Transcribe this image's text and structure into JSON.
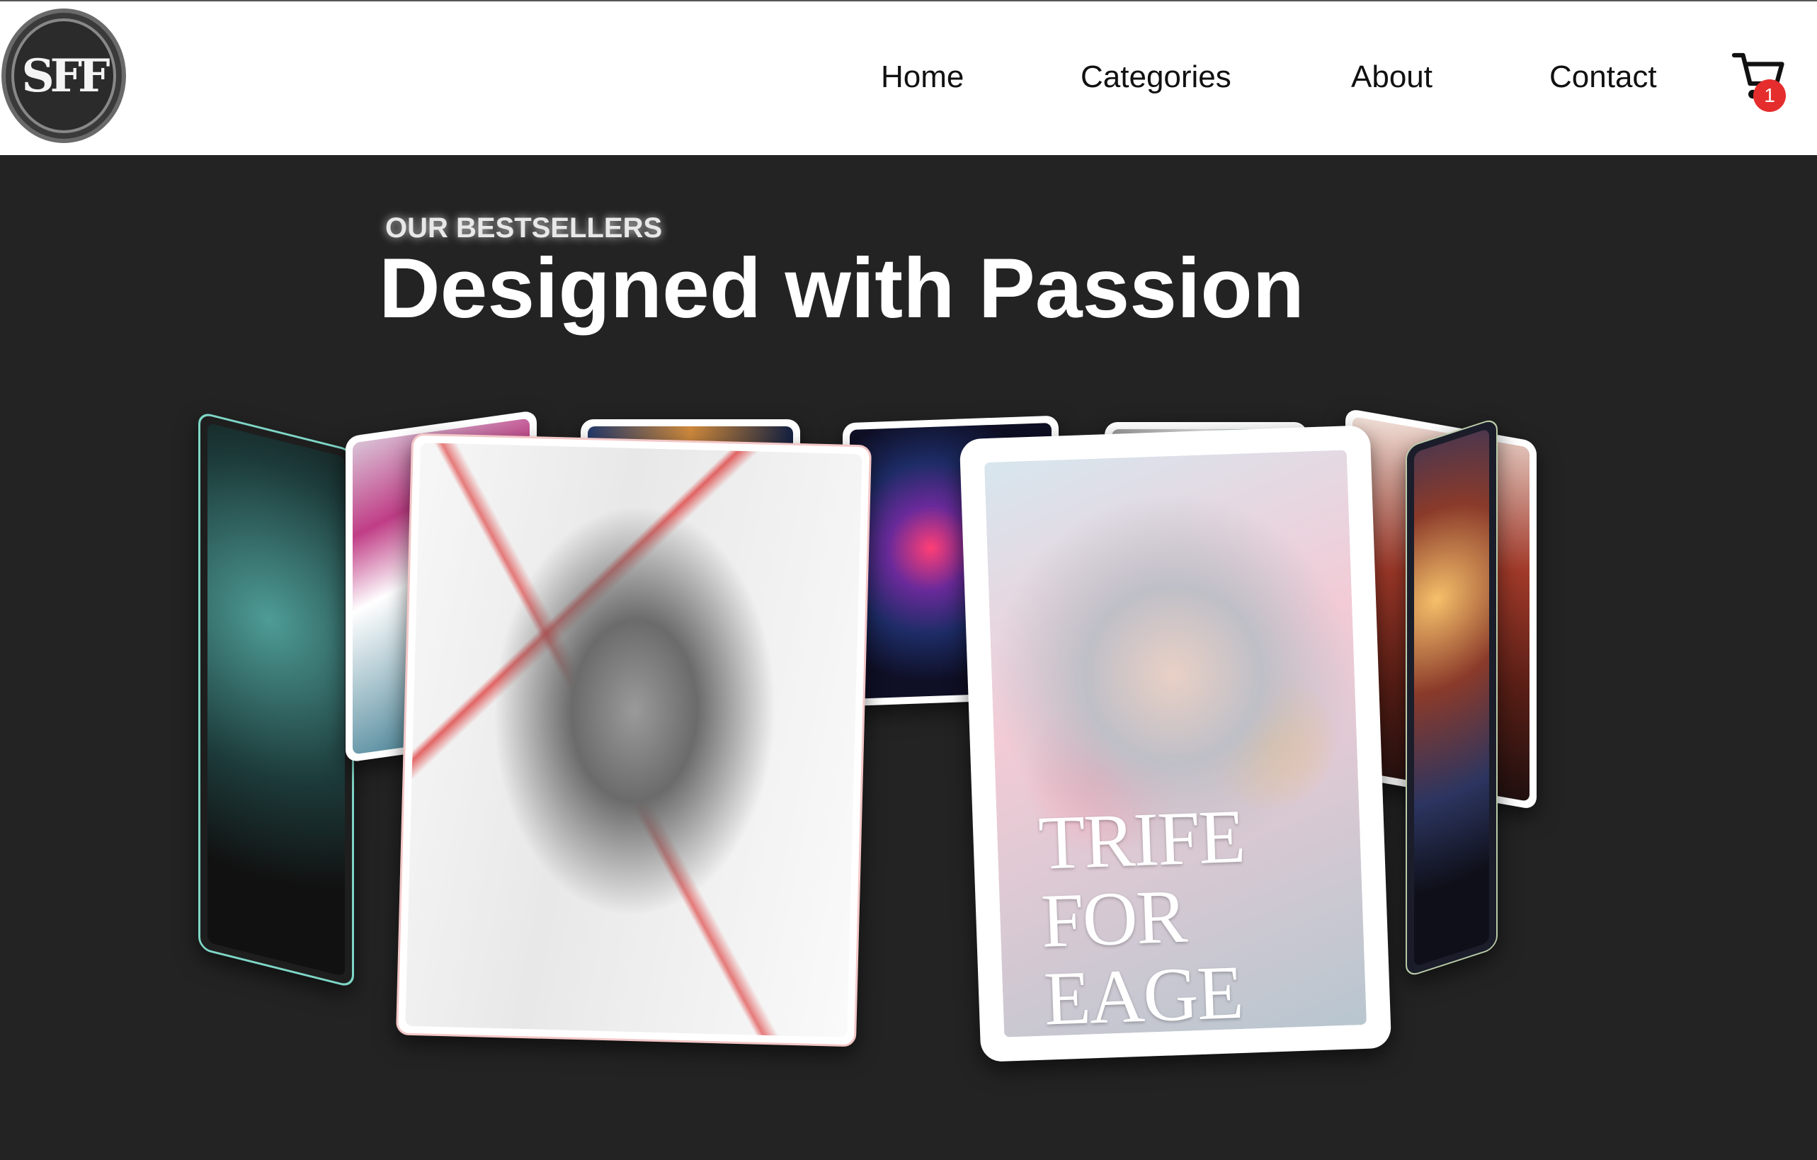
{
  "header": {
    "logo_text": "SFF",
    "nav": [
      "Home",
      "Categories",
      "About",
      "Contact"
    ],
    "cart": {
      "icon": "shopping-cart-icon",
      "count": "1",
      "badge_color": "#e52d2d"
    }
  },
  "hero": {
    "eyebrow": "OUR BESTSELLERS",
    "headline": "Designed with Passion",
    "background": "#232323"
  },
  "carousel": {
    "featured_cover_title": "TRIFE FOR EAGE"
  }
}
